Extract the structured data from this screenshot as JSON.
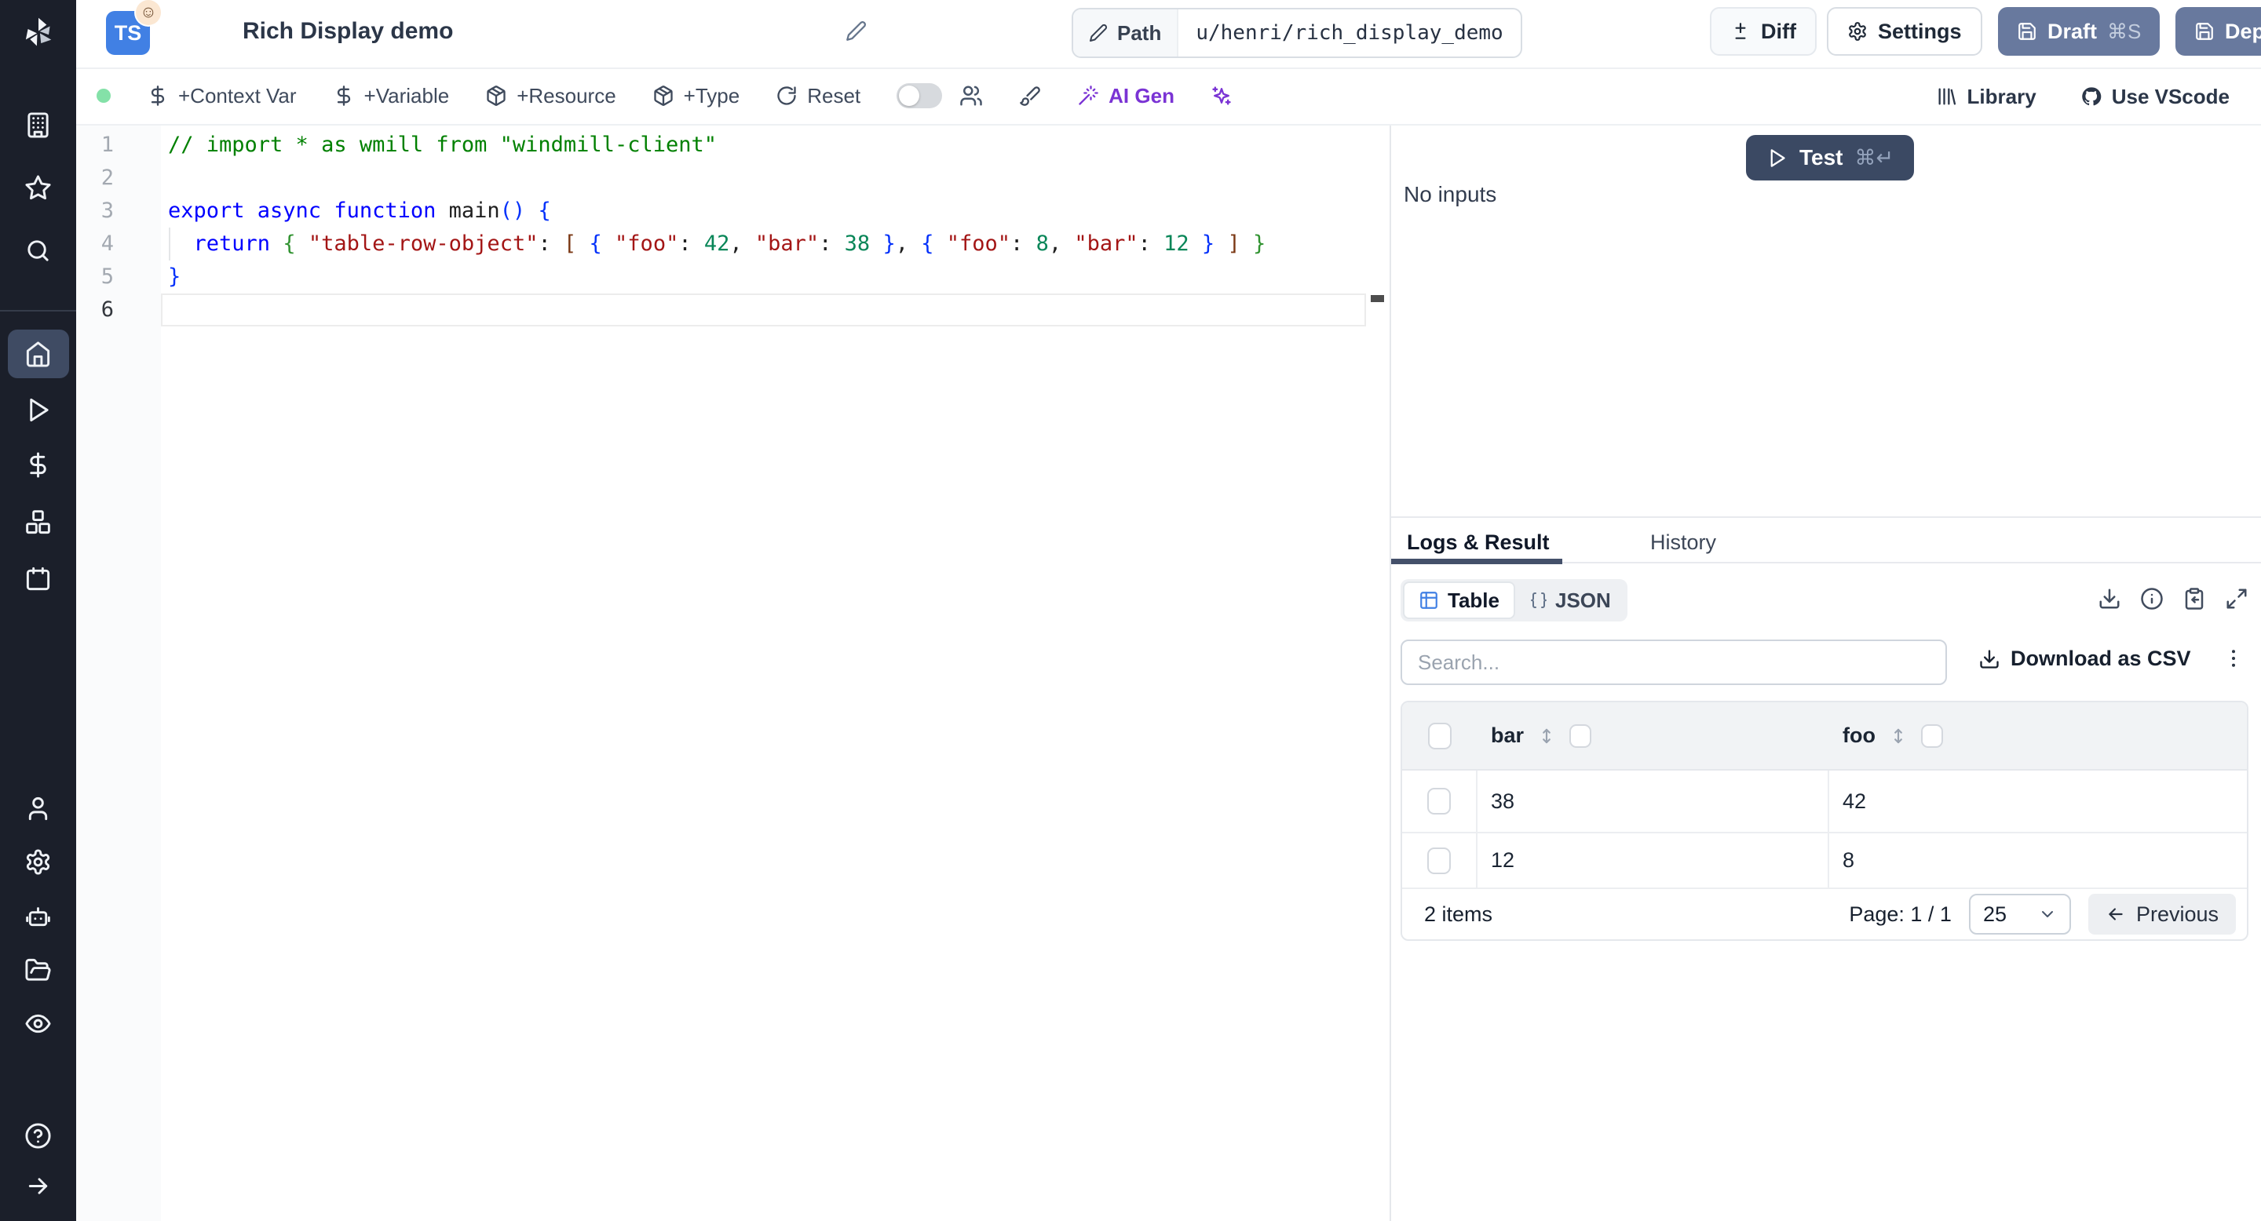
{
  "header": {
    "badge": "TS",
    "title": "Rich Display demo",
    "path_label": "Path",
    "path_value": "u/henri/rich_display_demo",
    "diff": "Diff",
    "settings": "Settings",
    "draft": "Draft",
    "draft_shortcut": "⌘S",
    "deploy": "Deploy"
  },
  "toolbar": {
    "context_var": "+Context Var",
    "variable": "+Variable",
    "resource": "+Resource",
    "type": "+Type",
    "reset": "Reset",
    "ai_gen": "AI Gen",
    "library": "Library",
    "vscode": "Use VScode"
  },
  "editor": {
    "lines": [
      {
        "num": "1",
        "tokens": [
          [
            "cm",
            "// import * as wmill from \"windmill-client\""
          ]
        ]
      },
      {
        "num": "2",
        "tokens": []
      },
      {
        "num": "3",
        "tokens": [
          [
            "kw",
            "export async function"
          ],
          [
            "pl",
            " "
          ],
          [
            "fn",
            "main"
          ],
          [
            "b1",
            "()"
          ],
          [
            "pl",
            " "
          ],
          [
            "b1",
            "{"
          ]
        ]
      },
      {
        "num": "4",
        "guide": true,
        "tokens": [
          [
            "pl",
            "  "
          ],
          [
            "kw",
            "return"
          ],
          [
            "pl",
            " "
          ],
          [
            "b2",
            "{"
          ],
          [
            "pl",
            " "
          ],
          [
            "st",
            "\"table-row-object\""
          ],
          [
            "pl",
            ": "
          ],
          [
            "b3",
            "["
          ],
          [
            "pl",
            " "
          ],
          [
            "b1",
            "{"
          ],
          [
            "pl",
            " "
          ],
          [
            "st",
            "\"foo\""
          ],
          [
            "pl",
            ": "
          ],
          [
            "nu",
            "42"
          ],
          [
            "pl",
            ", "
          ],
          [
            "st",
            "\"bar\""
          ],
          [
            "pl",
            ": "
          ],
          [
            "nu",
            "38"
          ],
          [
            "pl",
            " "
          ],
          [
            "b1",
            "}"
          ],
          [
            "pl",
            ", "
          ],
          [
            "b1",
            "{"
          ],
          [
            "pl",
            " "
          ],
          [
            "st",
            "\"foo\""
          ],
          [
            "pl",
            ": "
          ],
          [
            "nu",
            "8"
          ],
          [
            "pl",
            ", "
          ],
          [
            "st",
            "\"bar\""
          ],
          [
            "pl",
            ": "
          ],
          [
            "nu",
            "12"
          ],
          [
            "pl",
            " "
          ],
          [
            "b1",
            "}"
          ],
          [
            "pl",
            " "
          ],
          [
            "b3",
            "]"
          ],
          [
            "pl",
            " "
          ],
          [
            "b2",
            "}"
          ]
        ]
      },
      {
        "num": "5",
        "tokens": [
          [
            "b1",
            "}"
          ]
        ]
      },
      {
        "num": "6",
        "current": true,
        "tokens": []
      }
    ]
  },
  "run": {
    "test": "Test",
    "shortcut": "⌘↵",
    "no_inputs": "No inputs"
  },
  "result": {
    "tab_logs": "Logs & Result",
    "tab_history": "History",
    "view_table": "Table",
    "view_json": "JSON",
    "search_placeholder": "Search...",
    "download_csv": "Download as CSV",
    "table": {
      "col_bar": "bar",
      "col_foo": "foo",
      "rows": [
        {
          "bar": "38",
          "foo": "42"
        },
        {
          "bar": "12",
          "foo": "8"
        }
      ],
      "items": "2 items",
      "page": "Page: 1 / 1",
      "page_size": "25",
      "previous": "Previous"
    }
  },
  "colors": {
    "accent_blue": "#4180e4",
    "button_slate": "#68799e",
    "test_navy": "#3b4963",
    "ai_purple": "#7a33d4",
    "success_green": "#84e1a8",
    "sidebar_dark": "#1b1f2a"
  }
}
